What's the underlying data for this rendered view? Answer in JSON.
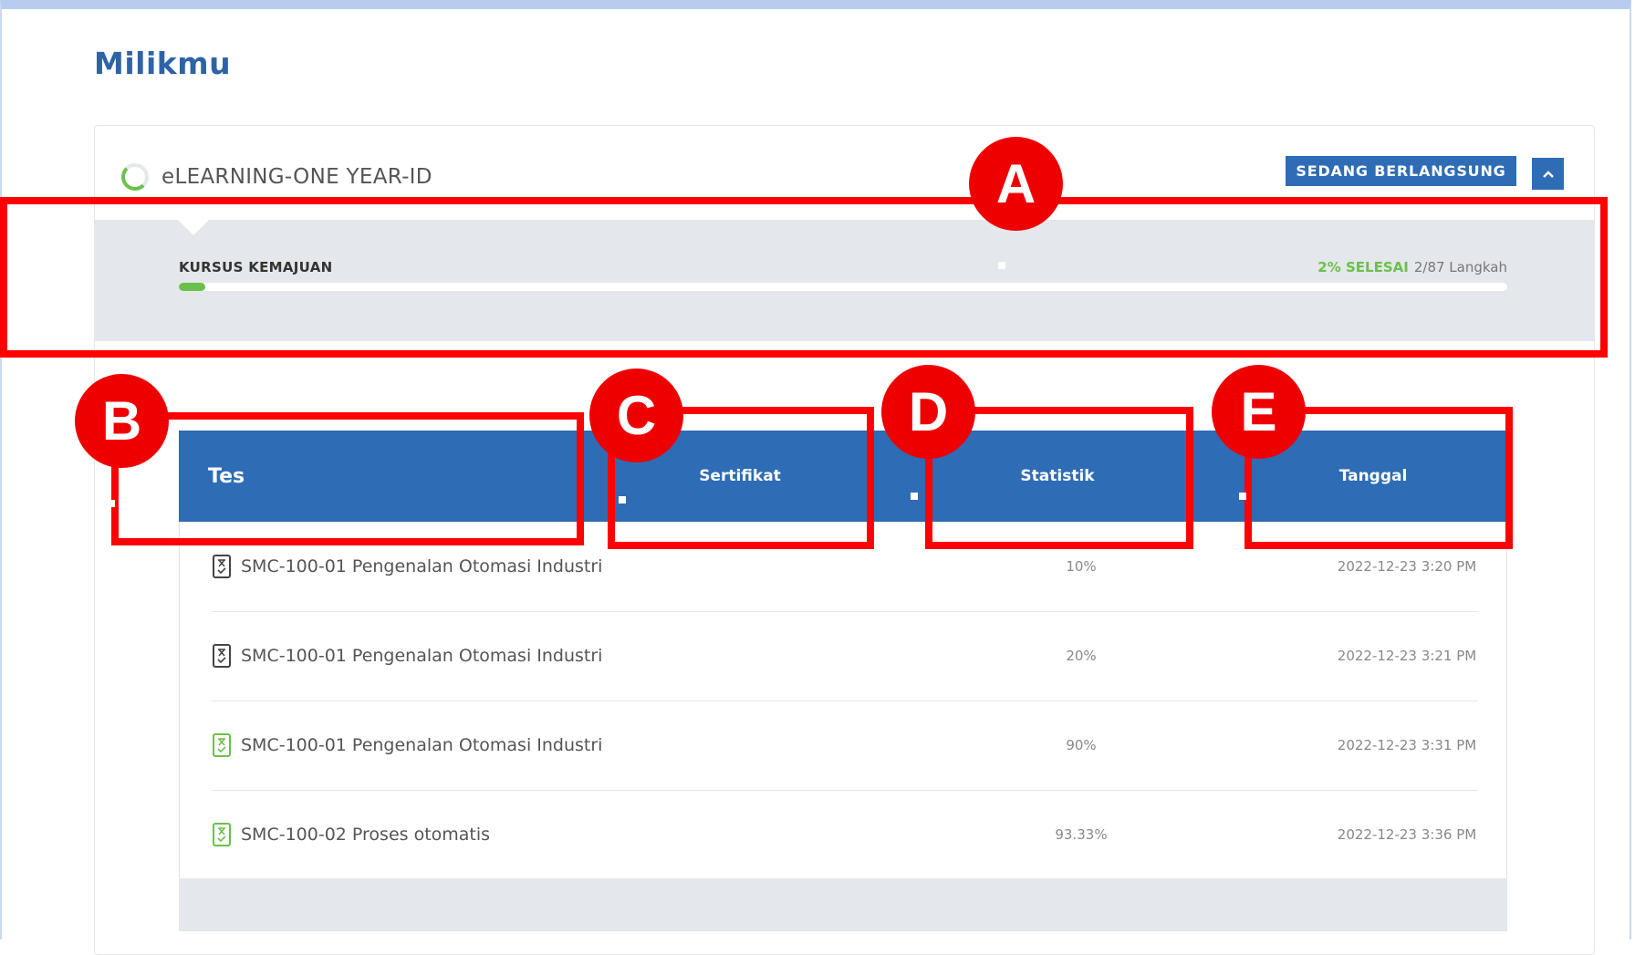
{
  "page": {
    "title": "Milikmu"
  },
  "course": {
    "name": "eLEARNING-ONE YEAR-ID",
    "status_badge": "SEDANG BERLANGSUNG",
    "progress": {
      "label": "KURSUS KEMAJUAN",
      "percent_done_label": "2% SELESAI",
      "steps_label": "2/87 Langkah",
      "fraction": 0.02
    }
  },
  "table": {
    "headers": {
      "tes": "Tes",
      "sertifikat": "Sertifikat",
      "statistik": "Statistik",
      "tanggal": "Tanggal"
    },
    "rows": [
      {
        "name": "SMC-100-01 Pengenalan Otomasi Industri",
        "statistik": "10%",
        "tanggal": "2022-12-23 3:20 PM",
        "passed": false
      },
      {
        "name": "SMC-100-01 Pengenalan Otomasi Industri",
        "statistik": "20%",
        "tanggal": "2022-12-23 3:21 PM",
        "passed": false
      },
      {
        "name": "SMC-100-01 Pengenalan Otomasi Industri",
        "statistik": "90%",
        "tanggal": "2022-12-23 3:31 PM",
        "passed": true
      },
      {
        "name": "SMC-100-02 Proses otomatis",
        "statistik": "93.33%",
        "tanggal": "2022-12-23 3:36 PM",
        "passed": true
      }
    ]
  },
  "annotations": {
    "a": "A",
    "b": "B",
    "c": "C",
    "d": "D",
    "e": "E"
  },
  "colors": {
    "primary": "#2e6cb5",
    "success": "#6bc04b",
    "annotation": "#ee0000",
    "panel": "#e4e7ec"
  },
  "icons": {
    "collapse": "chevron-up-icon",
    "spinner": "progress-ring-icon",
    "test": "quiz-timer-icon"
  }
}
